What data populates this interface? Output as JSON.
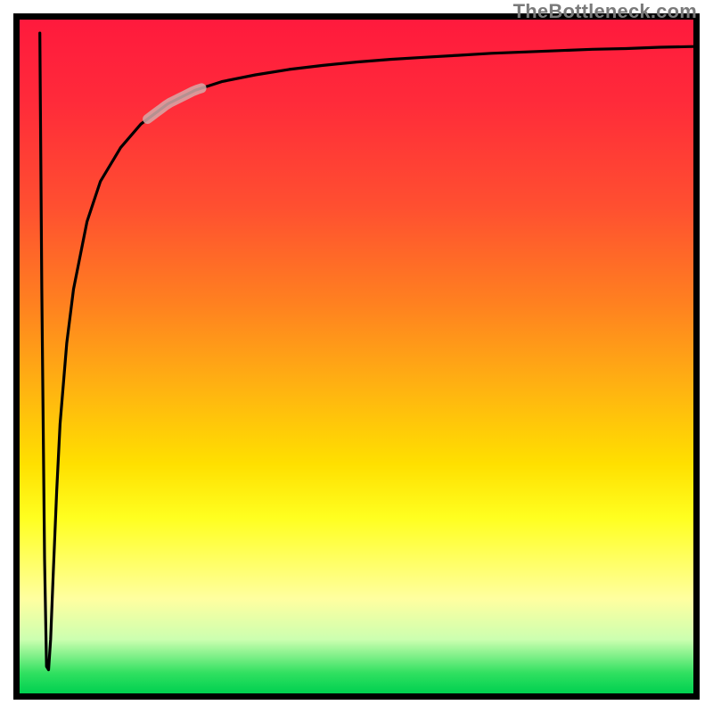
{
  "watermark": "TheBottleneck.com",
  "colors": {
    "frame": "#000000",
    "curve_stroke": "#000000",
    "highlight_stroke": "#d6a9a9"
  },
  "chart_data": {
    "type": "line",
    "title": "",
    "xlabel": "",
    "ylabel": "",
    "xlim": [
      0,
      100
    ],
    "ylim": [
      0,
      100
    ],
    "series": [
      {
        "name": "bottleneck-curve",
        "x": [
          3.0,
          3.3,
          3.7,
          4.0,
          4.3,
          4.6,
          5.0,
          5.5,
          6.0,
          7.0,
          8.0,
          10.0,
          12.0,
          15.0,
          18.0,
          22.0,
          26.0,
          30.0,
          35.0,
          40.0,
          45.0,
          50.0,
          55.0,
          60.0,
          65.0,
          70.0,
          75.0,
          80.0,
          85.0,
          90.0,
          95.0,
          100.0
        ],
        "y": [
          98.0,
          60.0,
          20.0,
          4.0,
          3.5,
          8.0,
          18.0,
          30.0,
          40.0,
          52.0,
          60.0,
          70.0,
          76.0,
          81.0,
          84.5,
          87.5,
          89.5,
          90.8,
          91.8,
          92.6,
          93.2,
          93.7,
          94.1,
          94.4,
          94.7,
          95.0,
          95.2,
          95.4,
          95.6,
          95.7,
          95.9,
          96.0
        ]
      }
    ],
    "highlight_range_x": [
      19,
      27
    ],
    "annotations": []
  }
}
